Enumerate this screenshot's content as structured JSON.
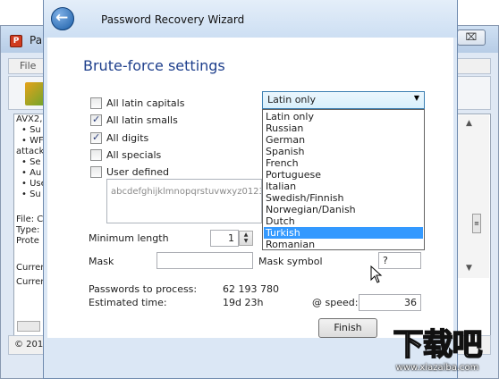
{
  "background_app": {
    "title": "Pa",
    "close_glyph": "⌧",
    "menu_file": "File",
    "lines": [
      "AVX2,",
      "• Su",
      "• WF",
      "attack",
      "• Se",
      "• Au",
      "• Use",
      "• Su",
      "File: C",
      "Type:",
      "Prote",
      "Curren",
      "Curren"
    ],
    "status_text": "© 201"
  },
  "wizard": {
    "title": "Password Recovery Wizard",
    "heading": "Brute-force settings",
    "checkboxes": [
      {
        "label": "All latin capitals",
        "checked": false
      },
      {
        "label": "All latin smalls",
        "checked": true
      },
      {
        "label": "All digits",
        "checked": true
      },
      {
        "label": "All specials",
        "checked": false
      },
      {
        "label": "User defined",
        "checked": false
      }
    ],
    "charset_preview": "abcdefghijklmnopqrstuvwxyz0123456789",
    "min_length_label": "Minimum length",
    "min_length_value": "1",
    "mask_label": "Mask",
    "mask_value": "",
    "mask_symbol_label": "Mask symbol",
    "mask_symbol_value": "?",
    "passwords_label": "Passwords to process:",
    "passwords_value": "62 193 780",
    "estimated_label": "Estimated time:",
    "estimated_value": "19d 23h",
    "speed_label": "@ speed:",
    "speed_value": "36",
    "finish_label": "Finish"
  },
  "language_dropdown": {
    "selected": "Latin only",
    "arrow": "▼",
    "options": [
      "Latin only",
      "Russian",
      "German",
      "Spanish",
      "French",
      "Portuguese",
      "Italian",
      "Swedish/Finnish",
      "Norwegian/Danish",
      "Dutch",
      "Turkish",
      "Romanian"
    ],
    "highlighted": "Turkish"
  },
  "watermark": {
    "text": "下载吧",
    "url": "www.xiazaiba.com"
  }
}
